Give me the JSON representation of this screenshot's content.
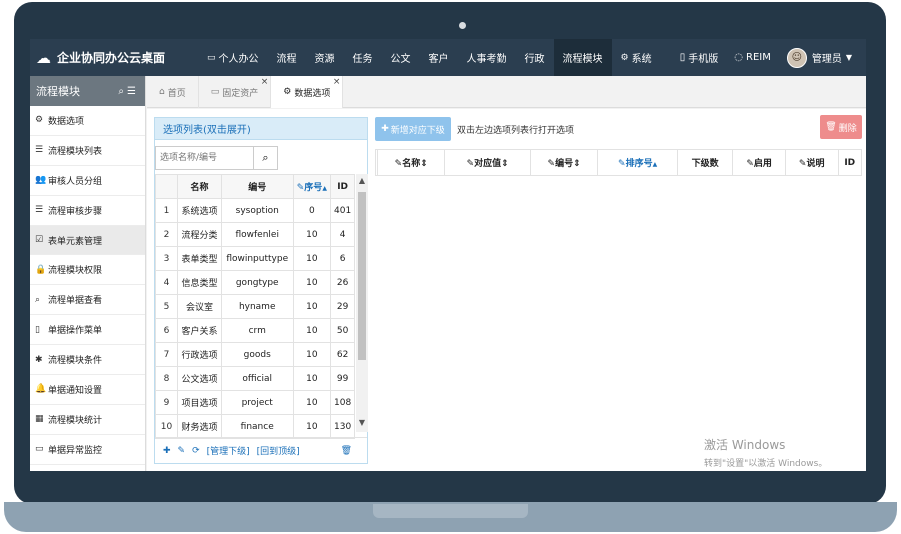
{
  "topbar": {
    "brand": "企业协同办公云桌面",
    "nav": [
      {
        "icon": "monitor-icon",
        "glyph": "▭",
        "label": "个人办公",
        "active": false
      },
      {
        "icon": "",
        "glyph": "",
        "label": "流程",
        "active": false
      },
      {
        "icon": "",
        "glyph": "",
        "label": "资源",
        "active": false
      },
      {
        "icon": "",
        "glyph": "",
        "label": "任务",
        "active": false
      },
      {
        "icon": "",
        "glyph": "",
        "label": "公文",
        "active": false
      },
      {
        "icon": "",
        "glyph": "",
        "label": "客户",
        "active": false
      },
      {
        "icon": "",
        "glyph": "",
        "label": "人事考勤",
        "active": false
      },
      {
        "icon": "",
        "glyph": "",
        "label": "行政",
        "active": false
      },
      {
        "icon": "",
        "glyph": "",
        "label": "流程模块",
        "active": true
      },
      {
        "icon": "gear-icon",
        "glyph": "⚙",
        "label": "系统",
        "active": false
      }
    ],
    "mobile_label": "手机版",
    "reim_label": "REIM",
    "user_label": "管理员"
  },
  "sidebar": {
    "title": "流程模块",
    "items": [
      {
        "icon": "gear-icon",
        "glyph": "⚙",
        "label": "数据选项"
      },
      {
        "icon": "list-icon",
        "glyph": "☰",
        "label": "流程模块列表"
      },
      {
        "icon": "users-icon",
        "glyph": "👥",
        "label": "审核人员分组"
      },
      {
        "icon": "list-icon",
        "glyph": "☰",
        "label": "流程审核步骤"
      },
      {
        "icon": "check-icon",
        "glyph": "☑",
        "label": "表单元素管理",
        "active": true
      },
      {
        "icon": "lock-icon",
        "glyph": "🔒",
        "label": "流程模块权限"
      },
      {
        "icon": "search-icon",
        "glyph": "⌕",
        "label": "流程单据查看"
      },
      {
        "icon": "bookmark-icon",
        "glyph": "▯",
        "label": "单据操作菜单"
      },
      {
        "icon": "asterisk-icon",
        "glyph": "✱",
        "label": "流程模块条件"
      },
      {
        "icon": "bell-icon",
        "glyph": "🔔",
        "label": "单据通知设置"
      },
      {
        "icon": "chart-icon",
        "glyph": "▦",
        "label": "流程模块统计"
      },
      {
        "icon": "monitor-icon",
        "glyph": "▭",
        "label": "单据异常监控"
      }
    ]
  },
  "tabs": [
    {
      "icon": "home-icon",
      "glyph": "⌂",
      "label": "首页",
      "closable": false,
      "active": false
    },
    {
      "icon": "monitor-icon",
      "glyph": "▭",
      "label": "固定资产",
      "closable": true,
      "active": false
    },
    {
      "icon": "gear-icon",
      "glyph": "⚙",
      "label": "数据选项",
      "closable": true,
      "active": true
    }
  ],
  "left_panel": {
    "title": "选项列表(双击展开)",
    "search_placeholder": "选项名称/编号",
    "columns": [
      "",
      "名称",
      "编号",
      "序号",
      "ID"
    ],
    "rows": [
      [
        "1",
        "系统选项",
        "sysoption",
        "0",
        "401"
      ],
      [
        "2",
        "流程分类",
        "flowfenlei",
        "10",
        "4"
      ],
      [
        "3",
        "表单类型",
        "flowinputtype",
        "10",
        "6"
      ],
      [
        "4",
        "信息类型",
        "gongtype",
        "10",
        "26"
      ],
      [
        "5",
        "会议室",
        "hyname",
        "10",
        "29"
      ],
      [
        "6",
        "客户关系",
        "crm",
        "10",
        "50"
      ],
      [
        "7",
        "行政选项",
        "goods",
        "10",
        "62"
      ],
      [
        "8",
        "公文选项",
        "official",
        "10",
        "99"
      ],
      [
        "9",
        "项目选项",
        "project",
        "10",
        "108"
      ],
      [
        "10",
        "财务选项",
        "finance",
        "10",
        "130"
      ]
    ],
    "manage_label": "[管理下级]",
    "top_label": "[回到顶级]"
  },
  "right_panel": {
    "add_label": "新增对应下级",
    "hint": "双击左边选项列表行打开选项",
    "delete_label": "删除",
    "columns": [
      "",
      "名称",
      "对应值",
      "编号",
      "排序号",
      "下级数",
      "启用",
      "说明",
      "ID"
    ]
  },
  "watermark": {
    "line1": "激活 Windows",
    "line2": "转到\"设置\"以激活 Windows。"
  }
}
